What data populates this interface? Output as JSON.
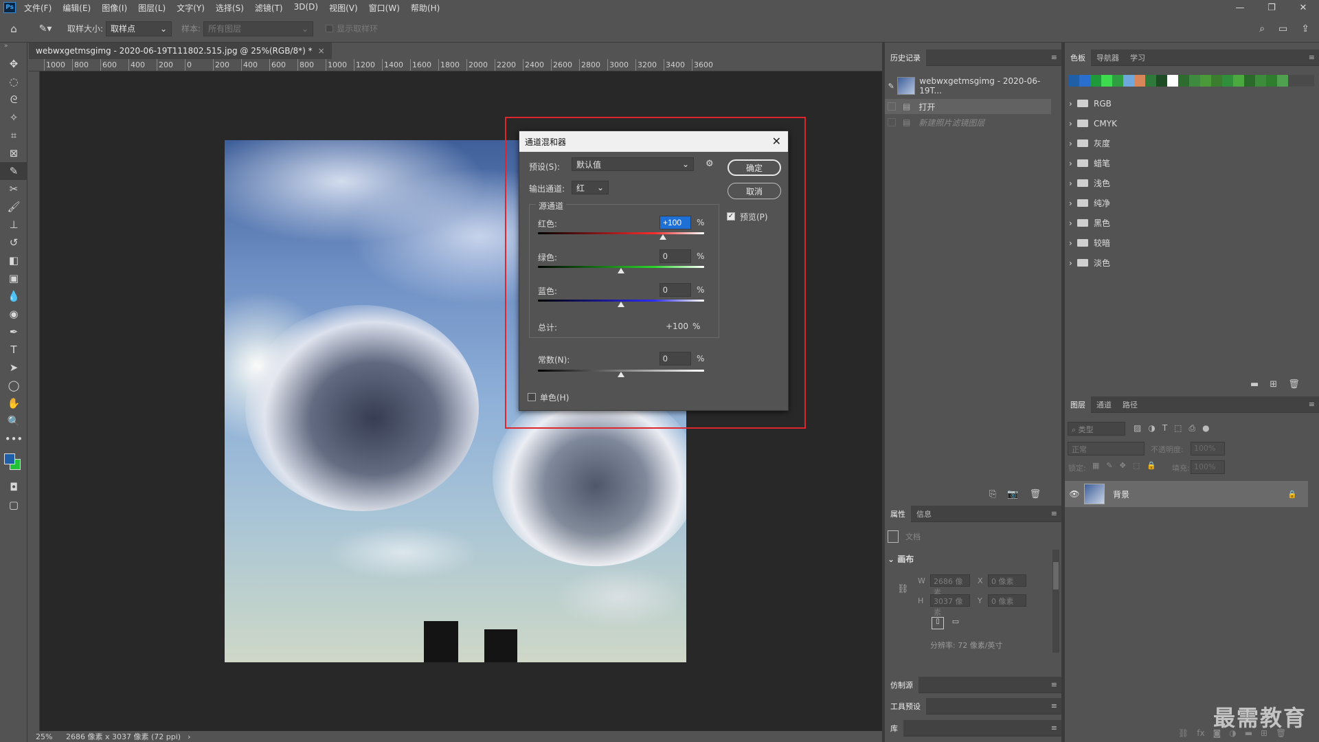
{
  "app": {
    "logo": "Ps"
  },
  "menu": [
    "文件(F)",
    "编辑(E)",
    "图像(I)",
    "图层(L)",
    "文字(Y)",
    "选择(S)",
    "滤镜(T)",
    "3D(D)",
    "视图(V)",
    "窗口(W)",
    "帮助(H)"
  ],
  "window_controls": {
    "minimize": "—",
    "restore": "❐",
    "close": "✕"
  },
  "options": {
    "sample_size_label": "取样大小:",
    "sample_size_value": "取样点",
    "sample_label": "样本:",
    "sample_value": "所有图层",
    "show_ring_label": "显示取样环"
  },
  "document": {
    "tab_title": "webwxgetmsgimg - 2020-06-19T111802.515.jpg @ 25%(RGB/8*) *",
    "tab_close": "×",
    "zoom": "25%",
    "size_info": "2686 像素 x 3037 像素 (72 ppi)",
    "status_arrow": "›"
  },
  "ruler_h": [
    "1000",
    "800",
    "600",
    "400",
    "200",
    "0",
    "200",
    "400",
    "600",
    "800",
    "1000",
    "1200",
    "1400",
    "1600",
    "1800",
    "2000",
    "2200",
    "2400",
    "2600",
    "2800",
    "3000",
    "3200",
    "3400",
    "3600"
  ],
  "dialog": {
    "title": "通道混和器",
    "close": "✕",
    "preset_label": "预设(S):",
    "preset_value": "默认值",
    "output_label": "输出通道:",
    "output_value": "红",
    "source_group": "源通道",
    "red_label": "红色:",
    "red_value": "+100",
    "green_label": "绿色:",
    "green_value": "0",
    "blue_label": "蓝色:",
    "blue_value": "0",
    "total_label": "总计:",
    "total_value": "+100",
    "constant_label": "常数(N):",
    "constant_value": "0",
    "percent": "%",
    "mono_label": "单色(H)",
    "ok": "确定",
    "cancel": "取消",
    "preview_label": "预览(P)",
    "preview_checked": true,
    "mono_checked": false,
    "slider_levels": {
      "red": 100,
      "green": 0,
      "blue": 0,
      "constant": 0
    }
  },
  "history": {
    "tab": "历史记录",
    "snapshot": "webwxgetmsgimg - 2020-06-19T...",
    "items": [
      "打开",
      "新建照片滤镜图层"
    ]
  },
  "swatches": {
    "tabs": [
      "色板",
      "导航器",
      "学习"
    ],
    "colors": [
      "#1f5fa8",
      "#2a6ecf",
      "#1f9a3a",
      "#3ddc4e",
      "#2f9e40",
      "#6fa8dc",
      "#d9865a",
      "#2f7a3a",
      "#1e4d25",
      "#ffffff",
      "#2e6b2e",
      "#3e8a3e",
      "#4a9a3a",
      "#3b7d2f",
      "#2f8f3a",
      "#4aaa40",
      "#2a6a2a",
      "#3c8c3c",
      "#2e7e2e",
      "#4fa04f"
    ],
    "groups": [
      "RGB",
      "CMYK",
      "灰度",
      "蜡笔",
      "浅色",
      "纯净",
      "黑色",
      "较暗",
      "淡色"
    ]
  },
  "properties": {
    "tabs": [
      "属性",
      "信息"
    ],
    "doc_label": "文档",
    "canvas_label": "画布",
    "w_label": "W",
    "w_value": "2686 像素",
    "h_label": "H",
    "h_value": "3037 像素",
    "x_label": "X",
    "x_value": "0 像素",
    "y_label": "Y",
    "y_value": "0 像素",
    "resolution": "分辨率: 72 像素/英寸"
  },
  "collapsed_panels": [
    "仿制源",
    "工具预设",
    "库"
  ],
  "layers": {
    "tabs": [
      "图层",
      "通道",
      "路径"
    ],
    "filter_placeholder": "类型",
    "blend_mode": "正常",
    "opacity_label": "不透明度:",
    "opacity_value": "100%",
    "lock_label": "锁定:",
    "fill_label": "填充:",
    "fill_value": "100%",
    "layer_name": "背景"
  },
  "watermark": "最需教育"
}
